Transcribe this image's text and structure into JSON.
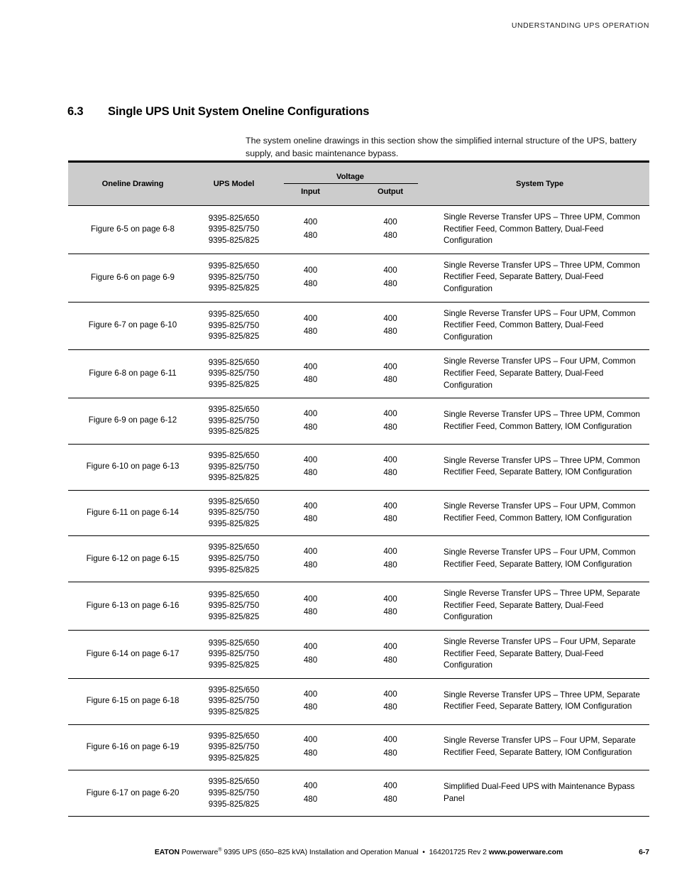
{
  "running_header": "UNDERSTANDING UPS OPERATION",
  "section": {
    "number": "6.3",
    "title": "Single UPS Unit System Oneline Configurations",
    "intro": "The system oneline drawings in this section show the simplified internal structure of the UPS, battery supply, and basic maintenance bypass."
  },
  "table": {
    "headers": {
      "drawing": "Oneline Drawing",
      "model": "UPS Model",
      "voltage": "Voltage",
      "input": "Input",
      "output": "Output",
      "system_type": "System Type"
    },
    "header_bg": "#cccccc",
    "rows": [
      {
        "drawing": "Figure 6-5 on page 6-8",
        "model": "9395-825/650\n9395-825/750\n9395-825/825",
        "input": "400\n480",
        "output": "400\n480",
        "system_type": "Single Reverse Transfer UPS – Three UPM, Common Rectifier Feed, Common Battery, Dual-Feed Configuration"
      },
      {
        "drawing": "Figure 6-6 on page 6-9",
        "model": "9395-825/650\n9395-825/750\n9395-825/825",
        "input": "400\n480",
        "output": "400\n480",
        "system_type": "Single Reverse Transfer UPS – Three UPM, Common Rectifier Feed, Separate Battery, Dual-Feed Configuration"
      },
      {
        "drawing": "Figure 6-7 on page 6-10",
        "model": "9395-825/650\n9395-825/750\n9395-825/825",
        "input": "400\n480",
        "output": "400\n480",
        "system_type": "Single Reverse Transfer UPS – Four UPM, Common Rectifier Feed, Common Battery, Dual-Feed Configuration"
      },
      {
        "drawing": "Figure 6-8 on page 6-11",
        "model": "9395-825/650\n9395-825/750\n9395-825/825",
        "input": "400\n480",
        "output": "400\n480",
        "system_type": "Single Reverse Transfer UPS – Four UPM, Common Rectifier Feed, Separate Battery, Dual-Feed Configuration"
      },
      {
        "drawing": "Figure 6-9 on page 6-12",
        "model": "9395-825/650\n9395-825/750\n9395-825/825",
        "input": "400\n480",
        "output": "400\n480",
        "system_type": "Single Reverse Transfer UPS – Three UPM, Common Rectifier Feed, Common Battery, IOM Configuration"
      },
      {
        "drawing": "Figure 6-10 on page 6-13",
        "model": "9395-825/650\n9395-825/750\n9395-825/825",
        "input": "400\n480",
        "output": "400\n480",
        "system_type": "Single Reverse Transfer UPS – Three UPM, Common Rectifier Feed, Separate Battery, IOM Configuration"
      },
      {
        "drawing": "Figure 6-11 on page 6-14",
        "model": "9395-825/650\n9395-825/750\n9395-825/825",
        "input": "400\n480",
        "output": "400\n480",
        "system_type": "Single Reverse Transfer UPS – Four UPM, Common Rectifier Feed, Common Battery, IOM Configuration"
      },
      {
        "drawing": "Figure 6-12 on page 6-15",
        "model": "9395-825/650\n9395-825/750\n9395-825/825",
        "input": "400\n480",
        "output": "400\n480",
        "system_type": "Single Reverse Transfer UPS – Four UPM, Common Rectifier Feed, Separate Battery, IOM Configuration"
      },
      {
        "drawing": "Figure 6-13 on page 6-16",
        "model": "9395-825/650\n9395-825/750\n9395-825/825",
        "input": "400\n480",
        "output": "400\n480",
        "system_type": "Single Reverse Transfer UPS – Three UPM, Separate Rectifier Feed, Separate Battery, Dual-Feed Configuration"
      },
      {
        "drawing": "Figure 6-14 on page 6-17",
        "model": "9395-825/650\n9395-825/750\n9395-825/825",
        "input": "400\n480",
        "output": "400\n480",
        "system_type": "Single Reverse Transfer UPS – Four UPM, Separate Rectifier Feed, Separate Battery, Dual-Feed Configuration"
      },
      {
        "drawing": "Figure 6-15 on page 6-18",
        "model": "9395-825/650\n9395-825/750\n9395-825/825",
        "input": "400\n480",
        "output": "400\n480",
        "system_type": "Single Reverse Transfer UPS – Three UPM, Separate Rectifier Feed, Separate Battery, IOM Configuration"
      },
      {
        "drawing": "Figure 6-16 on page 6-19",
        "model": "9395-825/650\n9395-825/750\n9395-825/825",
        "input": "400\n480",
        "output": "400\n480",
        "system_type": "Single Reverse Transfer UPS – Four UPM, Separate Rectifier Feed, Separate Battery, IOM Configuration"
      },
      {
        "drawing": "Figure 6-17 on page 6-20",
        "model": "9395-825/650\n9395-825/750\n9395-825/825",
        "input": "400\n480",
        "output": "400\n480",
        "system_type": "Simplified Dual-Feed UPS with Maintenance Bypass Panel"
      }
    ]
  },
  "footer": {
    "brand": "EATON",
    "product": "Powerware",
    "registered_mark": "®",
    "description": " 9395 UPS (650–825 kVA) Installation and Operation Manual",
    "separator": "•",
    "doc_number": "164201725 Rev 2",
    "website": "www.powerware.com",
    "page_number": "6-7"
  }
}
